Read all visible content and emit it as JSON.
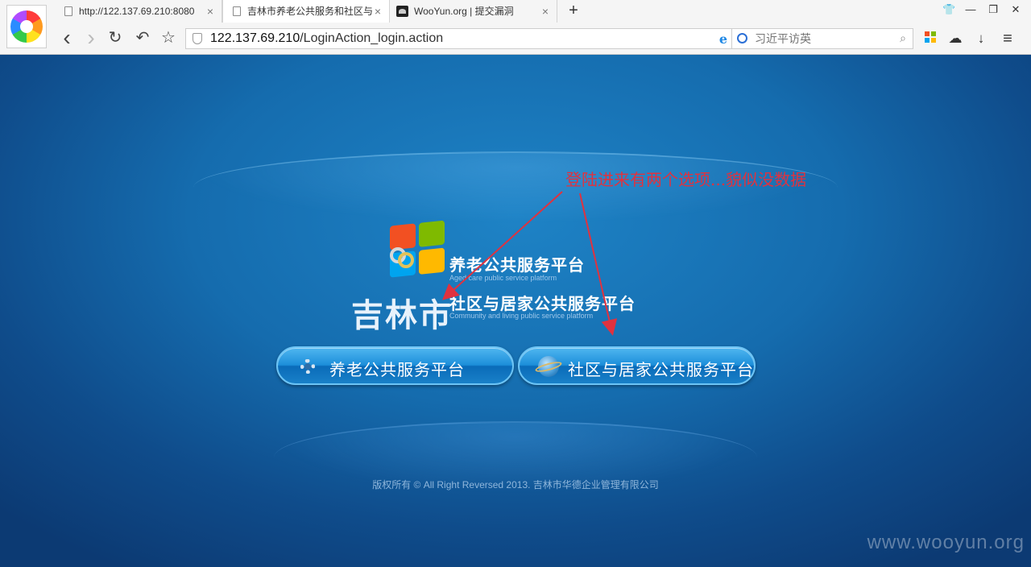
{
  "browser": {
    "tabs": [
      {
        "label": "http://122.137.69.210:8080",
        "close": "×"
      },
      {
        "label": "吉林市养老公共服务和社区与",
        "close": "×"
      },
      {
        "label": "WooYun.org | 提交漏洞",
        "close": "×"
      }
    ],
    "new_tab": "+",
    "window_controls": {
      "skin": "👕",
      "minimize": "—",
      "maximize": "❐",
      "close": "✕"
    },
    "nav": {
      "back": "‹",
      "forward": "›",
      "reload": "↻",
      "undo": "↶",
      "favorite": "☆"
    },
    "url": {
      "host": "122.137.69.210",
      "path": "/LoginAction_login.action"
    },
    "url_icons": {
      "ie": "e",
      "star": "☆",
      "dropdown": "∨"
    },
    "search": {
      "placeholder": "习近平访英",
      "icon": "⌕"
    },
    "tools": {
      "cloud": "☁",
      "download": "↓",
      "menu": "≡"
    },
    "tile_colors": [
      "#f25022",
      "#7fba00",
      "#00a4ef",
      "#ffb900"
    ]
  },
  "page": {
    "annotation": "登陆进来有两个选项...貌似没数据",
    "annotation_color": "#e0323f",
    "logo": {
      "city": "吉林市",
      "title_aged": "养老公共服务平台",
      "subtitle_aged": "Aged care public service platform",
      "title_community": "社区与居家公共服务平台",
      "subtitle_community": "Community and living public service platform",
      "flag_colors": [
        "#f25022",
        "#7fba00",
        "#00a4ef",
        "#ffb900"
      ]
    },
    "buttons": {
      "aged": "养老公共服务平台",
      "community": "社区与居家公共服务平台"
    },
    "footer": "版权所有 © All Right Reversed 2013. 吉林市华德企业管理有限公司",
    "watermark": "www.wooyun.org"
  },
  "icons": {
    "browser_logo": "browser-logo-icon",
    "page": "page-icon",
    "wooyun": "wooyun-icon",
    "shield": "shield-icon",
    "search": "search-icon",
    "gear": "gear-icon",
    "globe": "globe-icon"
  }
}
